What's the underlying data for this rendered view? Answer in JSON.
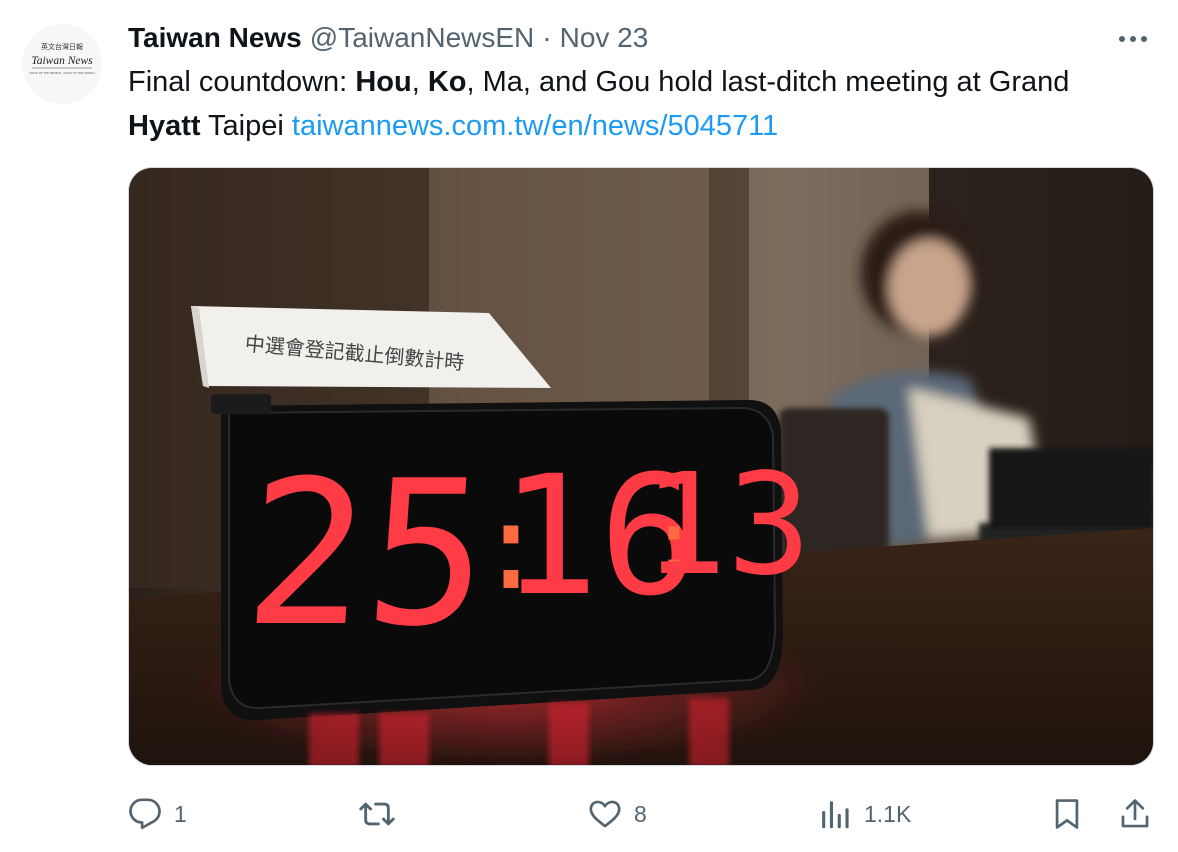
{
  "tweet": {
    "author": {
      "display_name": "Taiwan News",
      "handle": "@TaiwanNewsEN",
      "separator": "·",
      "date": "Nov 23"
    },
    "avatar": {
      "top_text": "英文台灣日報",
      "logo_text": "Taiwan News",
      "tag_text": "VOICE OF THE PEOPLE · VOICE TO THE WORLD"
    },
    "text": {
      "t1": "Final countdown: ",
      "b1": "Hou",
      "t2": ", ",
      "b2": "Ko",
      "t3": ", Ma, and Gou hold last-ditch meeting at Grand ",
      "b3": "Hyatt",
      "t4": " Taipei ",
      "link": "taiwannews.com.tw/en/news/5045711"
    },
    "media": {
      "sign_text": "中選會登記截止倒數計時",
      "clock": {
        "hours": "25",
        "minutes": "16",
        "seconds": "13",
        "colon": ":"
      }
    },
    "actions": {
      "reply_count": "1",
      "repost_count": "",
      "like_count": "8",
      "views_count": "1.1K"
    },
    "icons": {
      "more": "more-icon",
      "reply": "reply-icon",
      "repost": "repost-icon",
      "like": "heart-icon",
      "views": "views-icon",
      "bookmark": "bookmark-icon",
      "share": "share-icon"
    },
    "colors": {
      "text": "#0f1419",
      "secondary": "#536471",
      "link": "#1d9bf0",
      "led": "#ff3b46"
    }
  }
}
